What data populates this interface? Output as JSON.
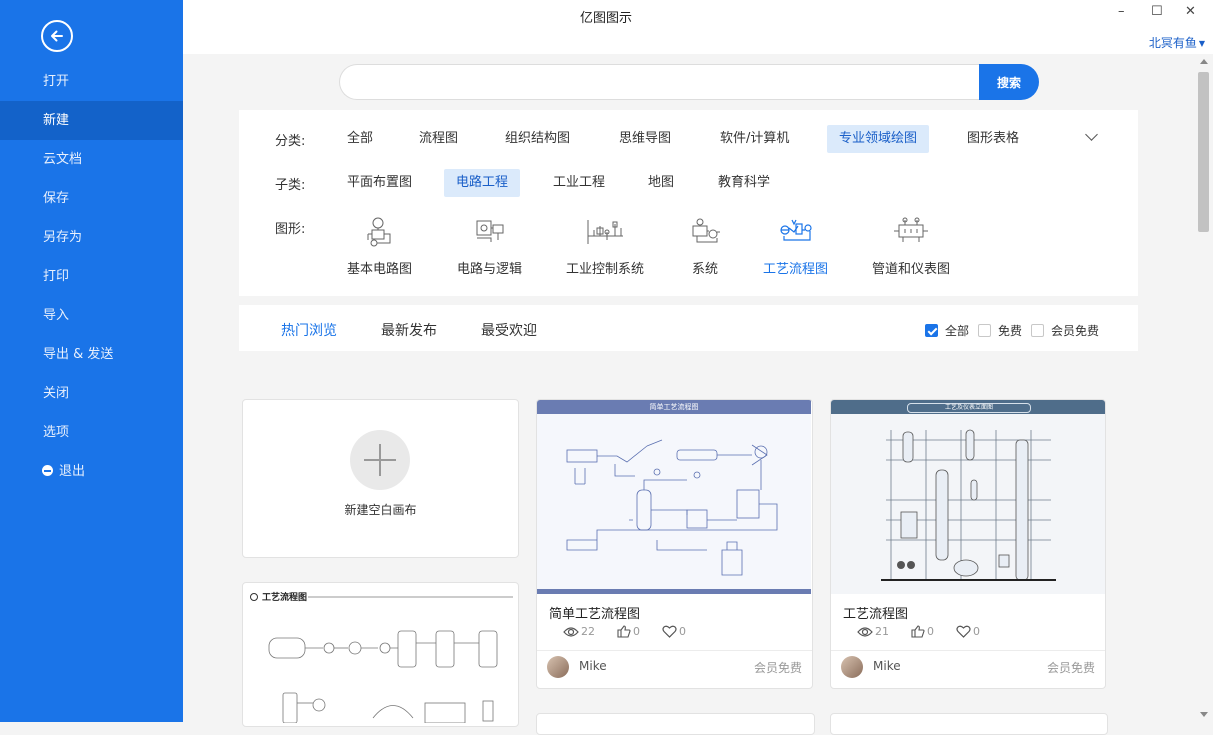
{
  "app": {
    "title": "亿图图示",
    "user": "北冥有鱼"
  },
  "window": {
    "minimize": "–",
    "maximize": "☐",
    "close": "✕"
  },
  "sidebar": {
    "items": [
      {
        "label": "打开"
      },
      {
        "label": "新建",
        "active": true
      },
      {
        "label": "云文档"
      },
      {
        "label": "保存"
      },
      {
        "label": "另存为"
      },
      {
        "label": "打印"
      },
      {
        "label": "导入"
      },
      {
        "label": "导出 & 发送"
      },
      {
        "label": "关闭"
      },
      {
        "label": "选项"
      },
      {
        "label": "退出"
      }
    ]
  },
  "search": {
    "placeholder": "",
    "button": "搜索"
  },
  "filters": {
    "category_label": "分类:",
    "categories": [
      "全部",
      "流程图",
      "组织结构图",
      "思维导图",
      "软件/计算机",
      "专业领域绘图",
      "图形表格"
    ],
    "category_selected": "专业领域绘图",
    "subclass_label": "子类:",
    "subclasses": [
      "平面布置图",
      "电路工程",
      "工业工程",
      "地图",
      "教育科学"
    ],
    "subclass_selected": "电路工程",
    "shape_label": "图形:",
    "shapes": [
      "基本电路图",
      "电路与逻辑",
      "工业控制系统",
      "系统",
      "工艺流程图",
      "管道和仪表图"
    ],
    "shape_selected": "工艺流程图"
  },
  "tabs": {
    "items": [
      "热门浏览",
      "最新发布",
      "最受欢迎"
    ],
    "selected": "热门浏览",
    "checks": [
      {
        "label": "全部",
        "checked": true
      },
      {
        "label": "免费",
        "checked": false
      },
      {
        "label": "会员免费",
        "checked": false
      }
    ]
  },
  "new_canvas": {
    "label": "新建空白画布"
  },
  "templates": [
    {
      "thumb_title": "简单工艺流程图",
      "title": "简单工艺流程图",
      "views": "22",
      "likes": "0",
      "favorites": "0",
      "author": "Mike",
      "tag": "会员免费"
    },
    {
      "thumb_title": "工艺及仪表立面图",
      "title": "工艺流程图",
      "views": "21",
      "likes": "0",
      "favorites": "0",
      "author": "Mike",
      "tag": "会员免费"
    }
  ],
  "partial_template": {
    "thumb_title": "工艺流程图"
  },
  "colors": {
    "accent": "#1a74e8",
    "sidebar": "#1a74e8",
    "sidebar_active": "#1362c9",
    "chip_selected_bg": "#dbeafb"
  }
}
